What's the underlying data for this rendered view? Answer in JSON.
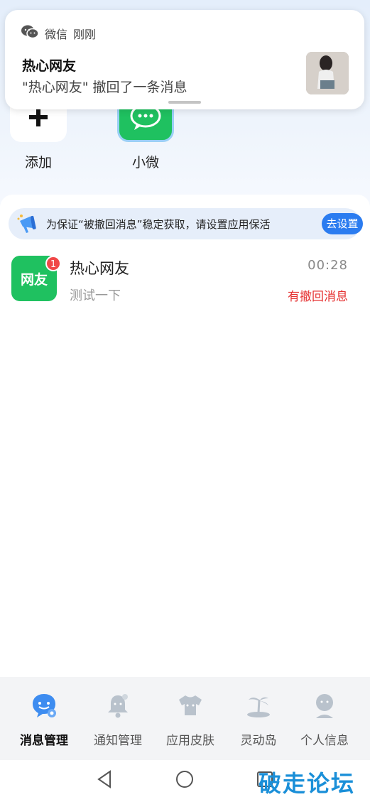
{
  "apps": [
    {
      "label": "添加",
      "icon": "plus-icon"
    },
    {
      "label": "小微",
      "icon": "wechat-icon"
    }
  ],
  "notification": {
    "app_name": "微信",
    "time": "刚刚",
    "title": "热心网友",
    "body": "\"热心网友\" 撤回了一条消息",
    "app_icon": "wechat-icon"
  },
  "keepalive": {
    "text": "为保证“被撤回消息”稳定获取，请设置应用保活",
    "button": "去设置",
    "icon": "megaphone-icon"
  },
  "chats": [
    {
      "avatar_text": "网友",
      "badge": "1",
      "name": "热心网友",
      "time": "00:28",
      "preview": "测试一下",
      "status": "有撤回消息"
    }
  ],
  "bottom_nav": [
    {
      "label": "消息管理",
      "icon": "message-icon",
      "active": true
    },
    {
      "label": "通知管理",
      "icon": "bell-icon",
      "active": false
    },
    {
      "label": "应用皮肤",
      "icon": "tshirt-icon",
      "active": false
    },
    {
      "label": "灵动岛",
      "icon": "island-icon",
      "active": false
    },
    {
      "label": "个人信息",
      "icon": "person-icon",
      "active": false
    }
  ],
  "watermark": "破走论坛",
  "colors": {
    "accent": "#2b7cf0",
    "wechat_green": "#1fc160",
    "alert_red": "#e53030"
  }
}
